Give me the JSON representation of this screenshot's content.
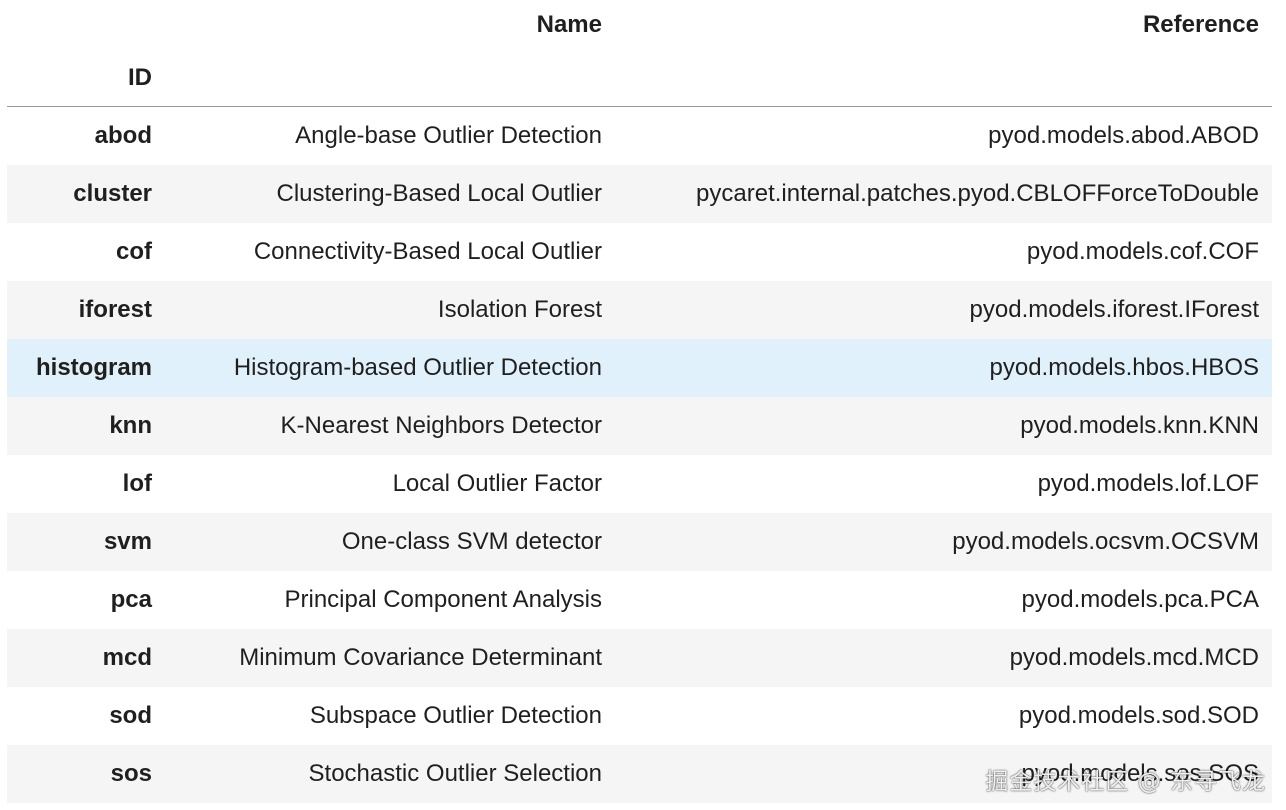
{
  "table": {
    "columns": {
      "name": "Name",
      "reference": "Reference"
    },
    "index_name": "ID",
    "rows": [
      {
        "id": "abod",
        "name": "Angle-base Outlier Detection",
        "reference": "pyod.models.abod.ABOD"
      },
      {
        "id": "cluster",
        "name": "Clustering-Based Local Outlier",
        "reference": "pycaret.internal.patches.pyod.CBLOFForceToDouble"
      },
      {
        "id": "cof",
        "name": "Connectivity-Based Local Outlier",
        "reference": "pyod.models.cof.COF"
      },
      {
        "id": "iforest",
        "name": "Isolation Forest",
        "reference": "pyod.models.iforest.IForest"
      },
      {
        "id": "histogram",
        "name": "Histogram-based Outlier Detection",
        "reference": "pyod.models.hbos.HBOS"
      },
      {
        "id": "knn",
        "name": "K-Nearest Neighbors Detector",
        "reference": "pyod.models.knn.KNN"
      },
      {
        "id": "lof",
        "name": "Local Outlier Factor",
        "reference": "pyod.models.lof.LOF"
      },
      {
        "id": "svm",
        "name": "One-class SVM detector",
        "reference": "pyod.models.ocsvm.OCSVM"
      },
      {
        "id": "pca",
        "name": "Principal Component Analysis",
        "reference": "pyod.models.pca.PCA"
      },
      {
        "id": "mcd",
        "name": "Minimum Covariance Determinant",
        "reference": "pyod.models.mcd.MCD"
      },
      {
        "id": "sod",
        "name": "Subspace Outlier Detection",
        "reference": "pyod.models.sod.SOD"
      },
      {
        "id": "sos",
        "name": "Stochastic Outlier Selection",
        "reference": "pyod.models.sos.SOS"
      }
    ],
    "highlighted_row": "histogram"
  },
  "watermark": "掘金技术社区 @ 东寻飞龙",
  "colors": {
    "stripe": "#f5f5f5",
    "hover": "#e1f1fb",
    "rule": "#9a9a9a"
  }
}
